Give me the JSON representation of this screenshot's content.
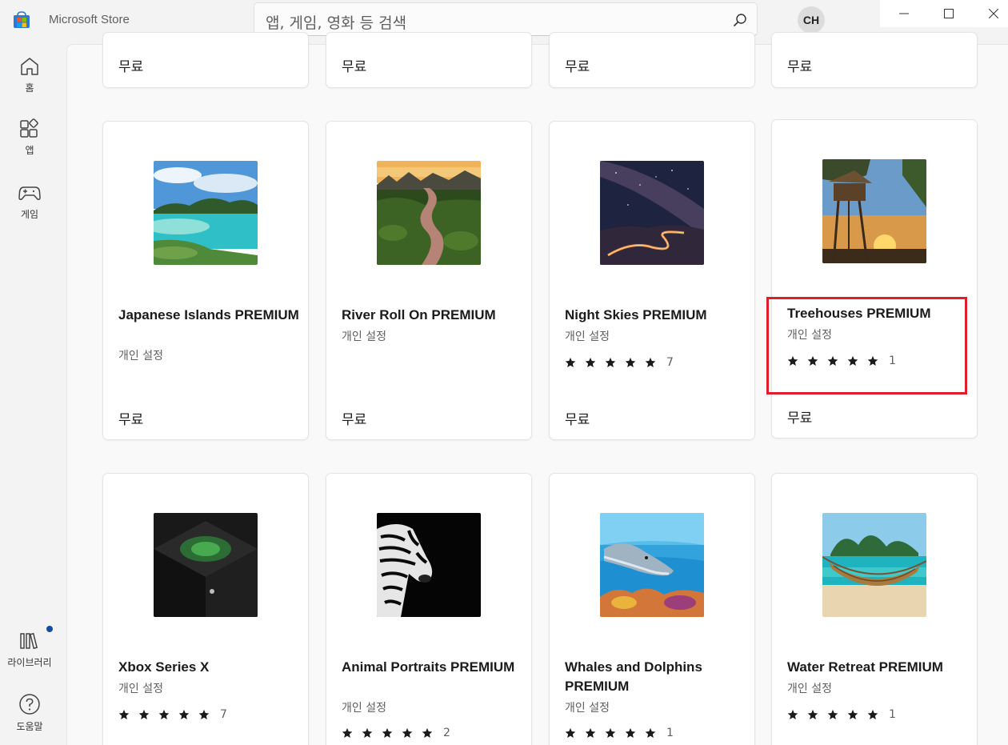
{
  "app": {
    "title": "Microsoft Store"
  },
  "search": {
    "placeholder": "앱, 게임, 영화 등 검색"
  },
  "user": {
    "initials": "CH"
  },
  "nav": [
    {
      "id": "home",
      "label": "홈",
      "icon": "home-icon"
    },
    {
      "id": "apps",
      "label": "앱",
      "icon": "apps-icon"
    },
    {
      "id": "games",
      "label": "게임",
      "icon": "gamepad-icon"
    },
    {
      "id": "library",
      "label": "라이브러리",
      "icon": "library-icon",
      "badge": true
    },
    {
      "id": "help",
      "label": "도움말",
      "icon": "help-icon"
    }
  ],
  "row0": [
    {
      "price": "무료"
    },
    {
      "price": "무료"
    },
    {
      "price": "무료"
    },
    {
      "price": "무료"
    }
  ],
  "row1": [
    {
      "name": "Japanese Islands PREMIUM",
      "category": "개인 설정",
      "price": "무료",
      "image": "tropical-islands"
    },
    {
      "name": "River Roll On PREMIUM",
      "category": "개인 설정",
      "price": "무료",
      "image": "river-valley"
    },
    {
      "name": "Night Skies PREMIUM",
      "category": "개인 설정",
      "rating_count": "7",
      "rating": 5,
      "price": "무료",
      "image": "milky-way-road"
    },
    {
      "name": "Treehouses PREMIUM",
      "category": "개인 설정",
      "rating_count": "1",
      "rating": 5,
      "price": "무료",
      "image": "treehouse-sunset"
    }
  ],
  "row2": [
    {
      "name": "Xbox Series X",
      "category": "개인 설정",
      "rating_count": "7",
      "rating": 5,
      "image": "xbox-console"
    },
    {
      "name": "Animal Portraits PREMIUM",
      "category": "개인 설정",
      "rating_count": "2",
      "rating": 5,
      "image": "zebra-portrait"
    },
    {
      "name": "Whales and Dolphins PREMIUM",
      "category": "개인 설정",
      "rating_count": "1",
      "rating": 5,
      "image": "dolphin-reef"
    },
    {
      "name": "Water Retreat PREMIUM",
      "category": "개인 설정",
      "rating_count": "1",
      "rating": 5,
      "image": "hammock-beach"
    }
  ],
  "colors": {
    "accent": "#0f4ea3",
    "highlight": "#e01e2b"
  }
}
